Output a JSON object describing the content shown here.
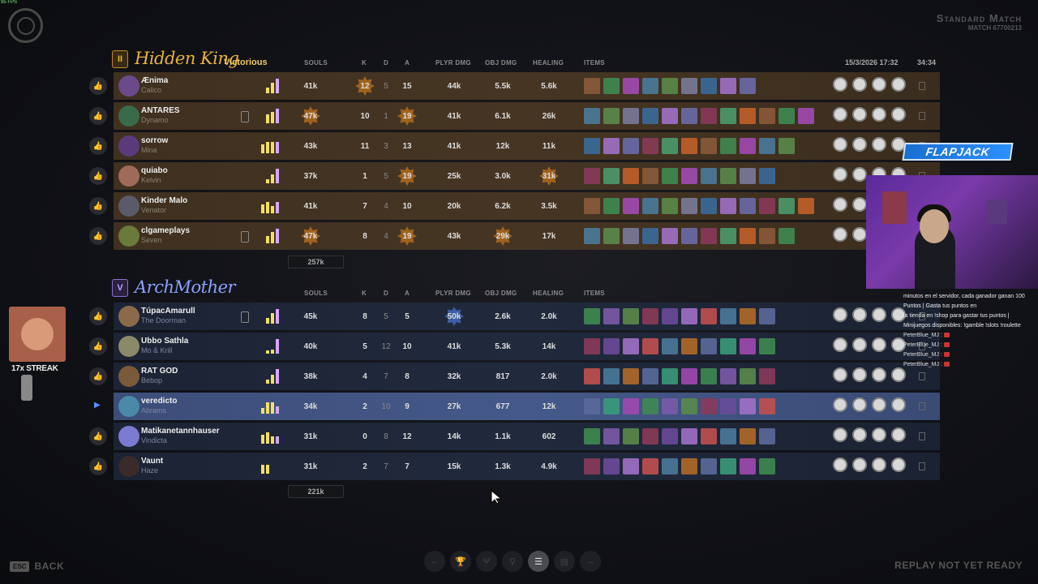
{
  "hud": {
    "fps": "95 FPS"
  },
  "match": {
    "title": "Standard Match",
    "id": "MATCH 67700213"
  },
  "datetime": "15/3/2026 17:32",
  "duration": "34:34",
  "columns": {
    "souls": "SOULS",
    "k": "K",
    "d": "D",
    "a": "A",
    "player_dmg": "PLYR DMG",
    "obj_dmg": "OBJ DMG",
    "healing": "HEALING",
    "items": "ITEMS"
  },
  "team_hidden_king": {
    "badge": "II",
    "name": "Hidden King",
    "result": "Victorious",
    "total_souls": "257k",
    "players": [
      {
        "name": "Ænima",
        "hero": "Calico",
        "souls": "41k",
        "k": "12",
        "d": "5",
        "a": "15",
        "pdmg": "44k",
        "odmg": "5.5k",
        "heal": "5.6k",
        "bars": [
          0,
          40,
          70,
          100
        ]
      },
      {
        "name": "ANTARES",
        "hero": "Dynamo",
        "souls": "47k",
        "k": "10",
        "d": "1",
        "a": "19",
        "pdmg": "41k",
        "odmg": "6.1k",
        "heal": "26k",
        "bars": [
          0,
          60,
          80,
          100
        ]
      },
      {
        "name": "sorrow",
        "hero": "Mina",
        "souls": "43k",
        "k": "11",
        "d": "3",
        "a": "13",
        "pdmg": "41k",
        "odmg": "12k",
        "heal": "11k",
        "bars": [
          60,
          80,
          80,
          80
        ]
      },
      {
        "name": "quiabo",
        "hero": "Kelvin",
        "souls": "37k",
        "k": "1",
        "d": "5",
        "a": "19",
        "pdmg": "25k",
        "odmg": "3.0k",
        "heal": "31k",
        "bars": [
          0,
          30,
          60,
          100
        ]
      },
      {
        "name": "Kinder Malo",
        "hero": "Venator",
        "souls": "41k",
        "k": "7",
        "d": "4",
        "a": "10",
        "pdmg": "20k",
        "odmg": "6.2k",
        "heal": "3.5k",
        "bars": [
          60,
          80,
          50,
          80
        ]
      },
      {
        "name": "clgameplays",
        "hero": "Seven",
        "souls": "47k",
        "k": "8",
        "d": "4",
        "a": "19",
        "pdmg": "43k",
        "odmg": "29k",
        "heal": "17k",
        "bars": [
          0,
          50,
          80,
          100
        ]
      }
    ]
  },
  "team_archmother": {
    "badge": "V",
    "name": "ArchMother",
    "total_souls": "221k",
    "players": [
      {
        "name": "TúpacAmarull",
        "hero": "The Doorman",
        "souls": "45k",
        "k": "8",
        "d": "5",
        "a": "5",
        "pdmg": "50k",
        "odmg": "2.6k",
        "heal": "2.0k",
        "bars": [
          0,
          40,
          70,
          100
        ]
      },
      {
        "name": "Ubbo Sathla",
        "hero": "Mo & Krill",
        "souls": "40k",
        "k": "5",
        "d": "12",
        "a": "10",
        "pdmg": "41k",
        "odmg": "5.3k",
        "heal": "14k",
        "bars": [
          0,
          20,
          30,
          100
        ]
      },
      {
        "name": "RAT GOD",
        "hero": "Bebop",
        "souls": "38k",
        "k": "4",
        "d": "7",
        "a": "8",
        "pdmg": "32k",
        "odmg": "817",
        "heal": "2.0k",
        "bars": [
          0,
          30,
          60,
          100
        ]
      },
      {
        "name": "veredicto",
        "hero": "Abrams",
        "souls": "34k",
        "k": "2",
        "d": "10",
        "a": "9",
        "pdmg": "27k",
        "odmg": "677",
        "heal": "12k",
        "bars": [
          40,
          80,
          80,
          50
        ]
      },
      {
        "name": "Matikanetannhauser",
        "hero": "Vindicta",
        "souls": "31k",
        "k": "0",
        "d": "8",
        "a": "12",
        "pdmg": "14k",
        "odmg": "1.1k",
        "heal": "602",
        "bars": [
          60,
          80,
          50,
          50
        ]
      },
      {
        "name": "Vaunt",
        "hero": "Haze",
        "souls": "31k",
        "k": "2",
        "d": "7",
        "a": "7",
        "pdmg": "15k",
        "odmg": "1.3k",
        "heal": "4.9k",
        "bars": [
          60,
          60,
          0,
          0
        ]
      }
    ]
  },
  "overlay": {
    "streak": "17x STREAK",
    "flapjack": "FLAPJACK",
    "chat": [
      "minutos en el servidor, cada ganador ganan 100 Puntos | Gasta tus puntos en",
      "la tienda en !shop para gastar tus puntos |",
      "Minijuegos disponibles: !gamble !slots !roulette"
    ],
    "chat_users": [
      "PeterBlue_MJ :",
      "PeterBlue_MJ :",
      "PeterBlue_MJ :",
      "PeterBlue_MJ :"
    ]
  },
  "footer": {
    "esc": "ESC",
    "back": "BACK",
    "replay": "REPLAY NOT YET READY"
  },
  "colors": {
    "hidden_king": "#e8b23a",
    "archmother": "#8aa2ff",
    "highlight": "#b87330"
  }
}
